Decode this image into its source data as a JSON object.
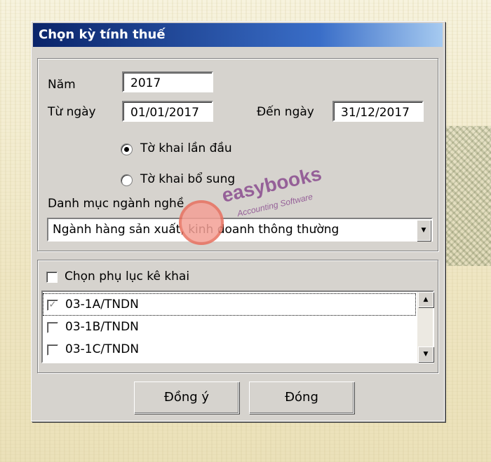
{
  "dialog": {
    "title": "Chọn kỳ tính thuế"
  },
  "period": {
    "year_label": "Năm",
    "year_value": "2017",
    "from_label": "Từ ngày",
    "from_value": "01/01/2017",
    "to_label": "Đến ngày",
    "to_value": "31/12/2017"
  },
  "declaration_type": {
    "options": [
      {
        "label": "Tờ khai lần đầu",
        "selected": true
      },
      {
        "label": "Tờ khai bổ sung",
        "selected": false
      }
    ]
  },
  "industry": {
    "label": "Danh mục ngành nghề",
    "selected": "Ngành hàng sản xuất, kinh doanh thông thường"
  },
  "appendix": {
    "select_all_label": "Chọn phụ lục kê khai",
    "select_all_checked": false,
    "items": [
      {
        "label": "03-1A/TNDN",
        "checked": true
      },
      {
        "label": "03-1B/TNDN",
        "checked": false
      },
      {
        "label": "03-1C/TNDN",
        "checked": false
      }
    ]
  },
  "buttons": {
    "ok": "Đồng ý",
    "close": "Đóng"
  },
  "watermark": {
    "brand": "easybooks",
    "tagline": "Accounting Software",
    "logo": "eb"
  },
  "colors": {
    "titlebar_start": "#0a246a",
    "titlebar_end": "#a6caf0",
    "dialog_face": "#d6d3ce"
  }
}
